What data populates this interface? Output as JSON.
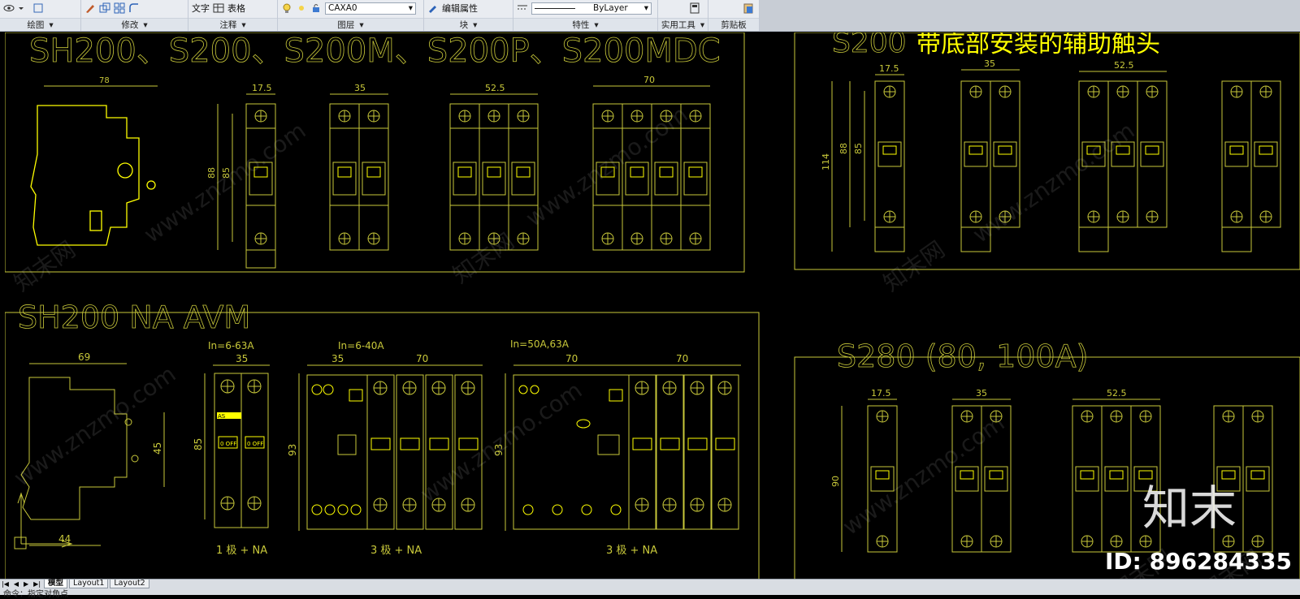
{
  "ribbon": {
    "groups": [
      {
        "footer": "绘图"
      },
      {
        "footer": "修改"
      },
      {
        "footer": "注释",
        "text_label": "文字",
        "table_label": "表格"
      },
      {
        "footer": "图层",
        "layer_value": "CAXA0"
      },
      {
        "footer": "块",
        "edit_attr_label": "编辑属性"
      },
      {
        "footer": "特性",
        "linetype_value": "ByLayer"
      },
      {
        "footer": "实用工具"
      },
      {
        "footer": "剪贴板"
      }
    ]
  },
  "drawing": {
    "title_sh200": "SH200、S200、S200M、S200P、S200MDC",
    "title_s200_right": "S200",
    "title_aux": "带底部安装的辅助触头",
    "title_na_avm": "SH200 NA AVM",
    "title_s280": "S280 (80, 100A)",
    "dims_top": [
      "78",
      "17.5",
      "35",
      "52.5",
      "70",
      "88",
      "85"
    ],
    "dims_right": [
      "17.5",
      "35",
      "52.5",
      "114",
      "88",
      "85"
    ],
    "dims_na": [
      "69",
      "45",
      "44",
      "35",
      "85",
      "35",
      "70",
      "93",
      "70",
      "70",
      "93"
    ],
    "current_labels": [
      "In=6-63A",
      "In=6-40A",
      "In=50A,63A"
    ],
    "pole_labels": [
      "1 极 + NA",
      "3 极 + NA",
      "3 极 + NA"
    ],
    "dims_s280": [
      "17.5",
      "35",
      "52.5",
      "90"
    ],
    "block_labels": [
      "AS",
      "0 OFF",
      "0 OFF"
    ]
  },
  "watermark": {
    "logo_text": "知末",
    "id_text": "ID: 896284335",
    "diagonal_text": "www.znzmo.com",
    "diagonal_cn": "知末网"
  },
  "status": {
    "tabs": [
      "模型",
      "Layout1",
      "Layout2"
    ],
    "command_text": "命令：指定对角点"
  },
  "colors": {
    "cad_line": "#c8c83a",
    "cad_bright": "#ffff00",
    "background": "#000000"
  }
}
